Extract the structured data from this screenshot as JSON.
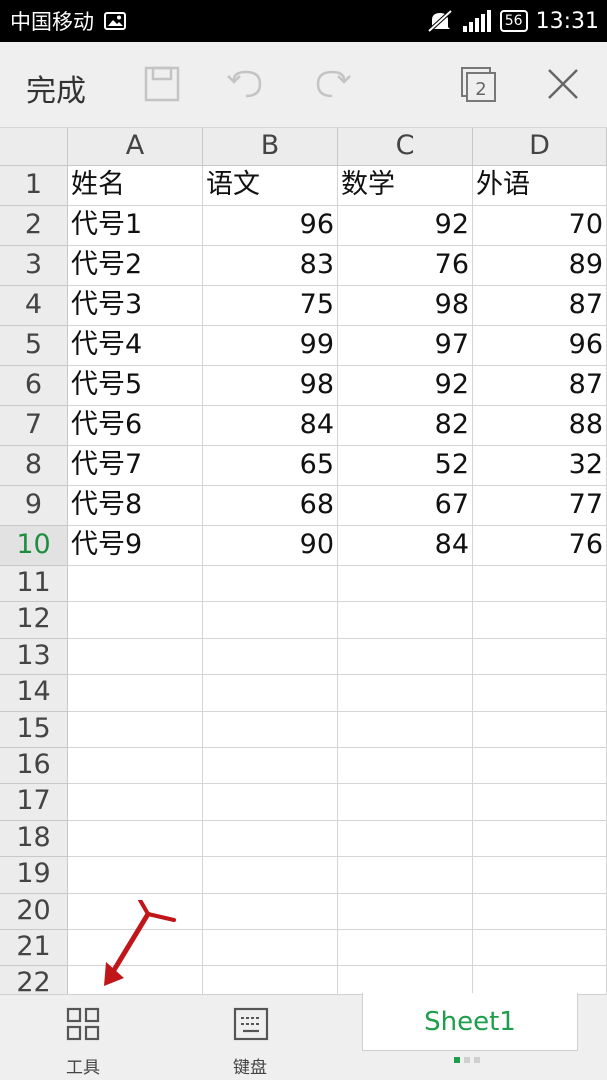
{
  "status_bar": {
    "carrier": "中国移动",
    "battery": "56",
    "time": "13:31"
  },
  "toolbar": {
    "done_label": "完成",
    "window_count": "2"
  },
  "sheet": {
    "columns": [
      "A",
      "B",
      "C",
      "D"
    ],
    "row_numbers": [
      "1",
      "2",
      "3",
      "4",
      "5",
      "6",
      "7",
      "8",
      "9",
      "10",
      "11",
      "12",
      "13",
      "14",
      "15",
      "16",
      "17",
      "18",
      "19",
      "20",
      "21",
      "22"
    ],
    "selected_row": "10",
    "rows": [
      [
        "姓名",
        "语文",
        "数学",
        "外语"
      ],
      [
        "代号1",
        "96",
        "92",
        "70"
      ],
      [
        "代号2",
        "83",
        "76",
        "89"
      ],
      [
        "代号3",
        "75",
        "98",
        "87"
      ],
      [
        "代号4",
        "99",
        "97",
        "96"
      ],
      [
        "代号5",
        "98",
        "92",
        "87"
      ],
      [
        "代号6",
        "84",
        "82",
        "88"
      ],
      [
        "代号7",
        "65",
        "52",
        "32"
      ],
      [
        "代号8",
        "68",
        "67",
        "77"
      ],
      [
        "代号9",
        "90",
        "84",
        "76"
      ]
    ]
  },
  "bottom_bar": {
    "tools_label": "工具",
    "keyboard_label": "键盘",
    "sheet_tab": "Sheet1"
  },
  "colors": {
    "accent": "#1e9e4a",
    "annotation_arrow": "#c0161a"
  }
}
